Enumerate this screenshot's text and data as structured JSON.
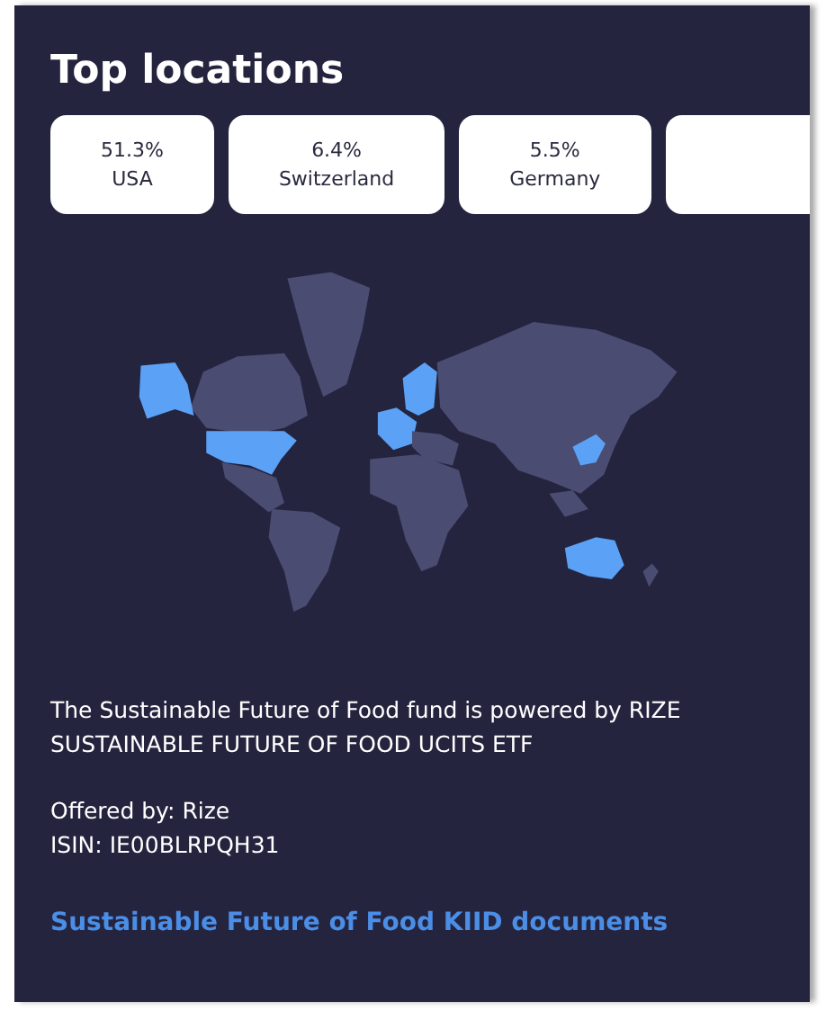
{
  "section": {
    "title": "Top locations"
  },
  "locations": [
    {
      "share": "51.3%",
      "country": "USA"
    },
    {
      "share": "6.4%",
      "country": "Switzerland"
    },
    {
      "share": "5.5%",
      "country": "Germany"
    }
  ],
  "more_locations_cut_off": true,
  "description": "The Sustainable Future of Food fund is powered by RIZE SUSTAINABLE FUTURE OF FOOD UCITS ETF",
  "details": [
    "Offered by: Rize",
    "ISIN: IE00BLRPQH31"
  ],
  "documents_link": "Sustainable Future of Food KIID documents"
}
